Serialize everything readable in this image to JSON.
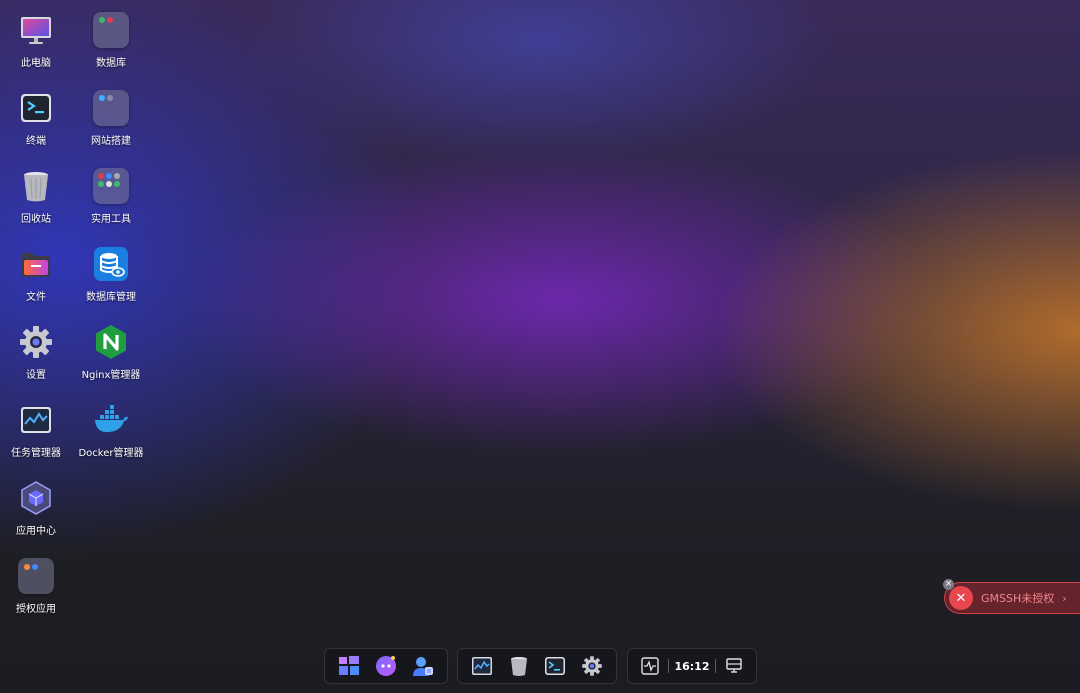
{
  "desktop": {
    "col1": [
      {
        "label": "此电脑",
        "icon": "computer-icon"
      },
      {
        "label": "终端",
        "icon": "terminal-icon"
      },
      {
        "label": "回收站",
        "icon": "recycle-bin-icon"
      },
      {
        "label": "文件",
        "icon": "folder-icon"
      },
      {
        "label": "设置",
        "icon": "gear-icon"
      },
      {
        "label": "任务管理器",
        "icon": "task-monitor-icon"
      },
      {
        "label": "应用中心",
        "icon": "app-center-icon"
      },
      {
        "label": "授权应用",
        "icon": "app-folder-icon"
      }
    ],
    "col2": [
      {
        "label": "数据库",
        "icon": "app-folder-icon"
      },
      {
        "label": "网站搭建",
        "icon": "app-folder-icon"
      },
      {
        "label": "实用工具",
        "icon": "app-folder-icon"
      },
      {
        "label": "数据库管理",
        "icon": "database-manager-icon"
      },
      {
        "label": "Nginx管理器",
        "icon": "nginx-icon"
      },
      {
        "label": "Docker管理器",
        "icon": "docker-icon"
      }
    ]
  },
  "taskbar": {
    "group1": [
      "start-menu-icon",
      "assistant-icon",
      "user-icon"
    ],
    "group2": [
      "task-monitor-icon",
      "recycle-bin-icon",
      "terminal-icon",
      "gear-icon"
    ],
    "clock": "16:12",
    "tray": [
      "activity-icon",
      "display-icon"
    ]
  },
  "notice": {
    "text": "GMSSH未授权",
    "chevron": "›",
    "color": "#e8464e"
  }
}
